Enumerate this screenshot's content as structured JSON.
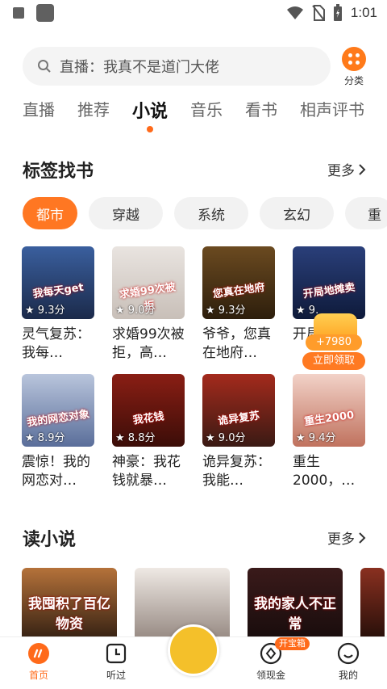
{
  "status_bar": {
    "time": "1:01"
  },
  "search": {
    "placeholder": "直播：我真不是道门大佬"
  },
  "category": {
    "label": "分类"
  },
  "tabs": [
    {
      "label": "直播"
    },
    {
      "label": "推荐"
    },
    {
      "label": "小说"
    },
    {
      "label": "音乐"
    },
    {
      "label": "看书"
    },
    {
      "label": "相声评书"
    }
  ],
  "tag_section": {
    "title": "标签找书",
    "more": "更多"
  },
  "chips": [
    "都市",
    "穿越",
    "系统",
    "玄幻",
    "重"
  ],
  "books_row1": [
    {
      "title": "灵气复苏：我每…",
      "rating": "9.3分",
      "cover_text": "我每天get",
      "colors": [
        "#3a5f9e",
        "#1b2a4a"
      ]
    },
    {
      "title": "求婚99次被拒，高…",
      "rating": "9.0分",
      "cover_text": "求婚99次被拒",
      "colors": [
        "#e9e4e0",
        "#c8bfb8"
      ]
    },
    {
      "title": "爷爷，您真在地府…",
      "rating": "9.3分",
      "cover_text": "您真在地府",
      "colors": [
        "#6b4a20",
        "#2d1e0c"
      ]
    },
    {
      "title": "开局…卖…",
      "rating": "9.",
      "cover_text": "开局地摊卖",
      "colors": [
        "#2a3f7a",
        "#0e1a3a"
      ]
    }
  ],
  "books_row2": [
    {
      "title": "震惊！我的网恋对…",
      "rating": "8.9分",
      "cover_text": "我的网恋对象",
      "colors": [
        "#b9c5dc",
        "#5a6e9a"
      ]
    },
    {
      "title": "神豪：我花钱就暴…",
      "rating": "8.8分",
      "cover_text": "我花钱",
      "colors": [
        "#8a1e14",
        "#3b0d08"
      ]
    },
    {
      "title": "诡异复苏：我能…",
      "rating": "9.0分",
      "cover_text": "诡异复苏",
      "colors": [
        "#a42a1c",
        "#3a1a14"
      ]
    },
    {
      "title": "重生2000，…",
      "rating": "9.4分",
      "cover_text": "重生2000",
      "colors": [
        "#f2d2c8",
        "#c0725e"
      ]
    }
  ],
  "reward": {
    "amount": "+7980",
    "label": "立即领取"
  },
  "read_section": {
    "title": "读小说",
    "more": "更多"
  },
  "read_books": [
    {
      "cover_text": "我囤积了百亿物资",
      "colors": [
        "#b5723a",
        "#3a2414"
      ]
    },
    {
      "cover_text": "",
      "colors": [
        "#efe9e4",
        "#9a8d86"
      ]
    },
    {
      "cover_text": "我的家人不正常",
      "colors": [
        "#3a1a1a",
        "#1a0d0d"
      ]
    },
    {
      "cover_text": "",
      "colors": [
        "#8a3020",
        "#2a100a"
      ]
    }
  ],
  "nav": {
    "home": "首页",
    "listened": "听过",
    "coins": "领现金",
    "treasure_badge": "开宝箱",
    "mine": "我的"
  },
  "accent": "#ff6a1a"
}
